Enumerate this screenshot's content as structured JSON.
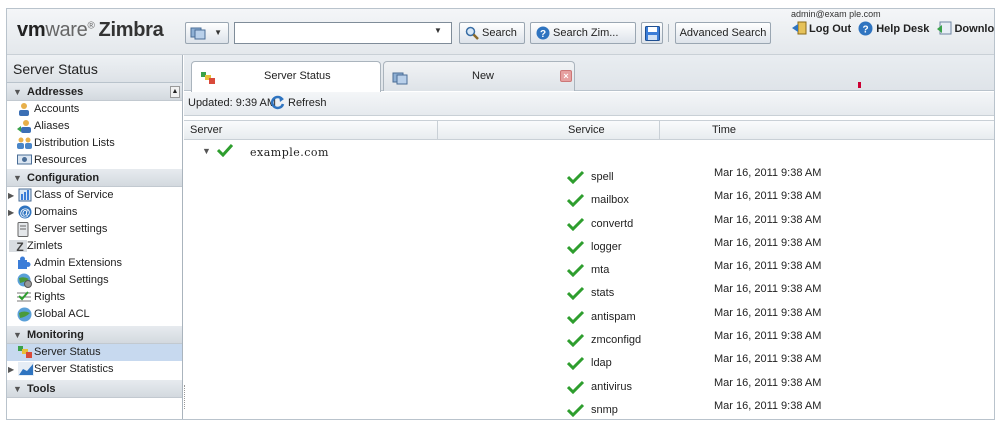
{
  "header": {
    "logo_vm": "vm",
    "logo_ware": "ware",
    "logo_zimbra": "Zimbra",
    "search_value": "",
    "search_label": "Search",
    "search_zimbra_label": "Search Zim...",
    "advanced_search_label": "Advanced Search",
    "user_email": "admin@exam ple.com",
    "logout_label": "Log Out",
    "helpdesk_label": "Help Desk",
    "downloads_label": "Downloads"
  },
  "sidebar": {
    "title": "Server Status",
    "sections": [
      {
        "label": "Addresses",
        "items": [
          {
            "label": "Accounts",
            "icon": "accounts-icon"
          },
          {
            "label": "Aliases",
            "icon": "aliases-icon"
          },
          {
            "label": "Distribution Lists",
            "icon": "distribution-lists-icon"
          },
          {
            "label": "Resources",
            "icon": "resources-icon"
          }
        ]
      },
      {
        "label": "Configuration",
        "items": [
          {
            "label": "Class of Service",
            "icon": "cos-icon"
          },
          {
            "label": "Domains",
            "icon": "domains-icon"
          },
          {
            "label": "Server settings",
            "icon": "server-settings-icon"
          },
          {
            "label": "Zimlets",
            "icon": "zimlets-icon"
          },
          {
            "label": "Admin Extensions",
            "icon": "admin-extensions-icon"
          },
          {
            "label": "Global Settings",
            "icon": "global-settings-icon"
          },
          {
            "label": "Rights",
            "icon": "rights-icon"
          },
          {
            "label": "Global ACL",
            "icon": "global-acl-icon"
          }
        ]
      },
      {
        "label": "Monitoring",
        "items": [
          {
            "label": "Server Status",
            "icon": "server-status-icon"
          },
          {
            "label": "Server Statistics",
            "icon": "server-statistics-icon"
          }
        ]
      },
      {
        "label": "Tools",
        "items": []
      }
    ]
  },
  "tabs": [
    {
      "label": "Server Status"
    },
    {
      "label": "New"
    }
  ],
  "toolbar": {
    "updated": "Updated: 9:39 AM",
    "refresh_label": "Refresh"
  },
  "grid": {
    "columns": [
      "Server",
      "Service",
      "Time"
    ],
    "server_name": "example.com",
    "rows": [
      {
        "service": "spell",
        "time": "Mar 16, 2011 9:38 AM"
      },
      {
        "service": "mailbox",
        "time": "Mar 16, 2011 9:38 AM"
      },
      {
        "service": "convertd",
        "time": "Mar 16, 2011 9:38 AM"
      },
      {
        "service": "logger",
        "time": "Mar 16, 2011 9:38 AM"
      },
      {
        "service": "mta",
        "time": "Mar 16, 2011 9:38 AM"
      },
      {
        "service": "stats",
        "time": "Mar 16, 2011 9:38 AM"
      },
      {
        "service": "antispam",
        "time": "Mar 16, 2011 9:38 AM"
      },
      {
        "service": "zmconfigd",
        "time": "Mar 16, 2011 9:38 AM"
      },
      {
        "service": "ldap",
        "time": "Mar 16, 2011 9:38 AM"
      },
      {
        "service": "antivirus",
        "time": "Mar 16, 2011 9:38 AM"
      },
      {
        "service": "snmp",
        "time": "Mar 16, 2011 9:38 AM"
      }
    ]
  },
  "colors": {
    "accent": "#1a66b3",
    "ok_green": "#2e9e2e",
    "selected_bg": "#c7d9ef"
  }
}
